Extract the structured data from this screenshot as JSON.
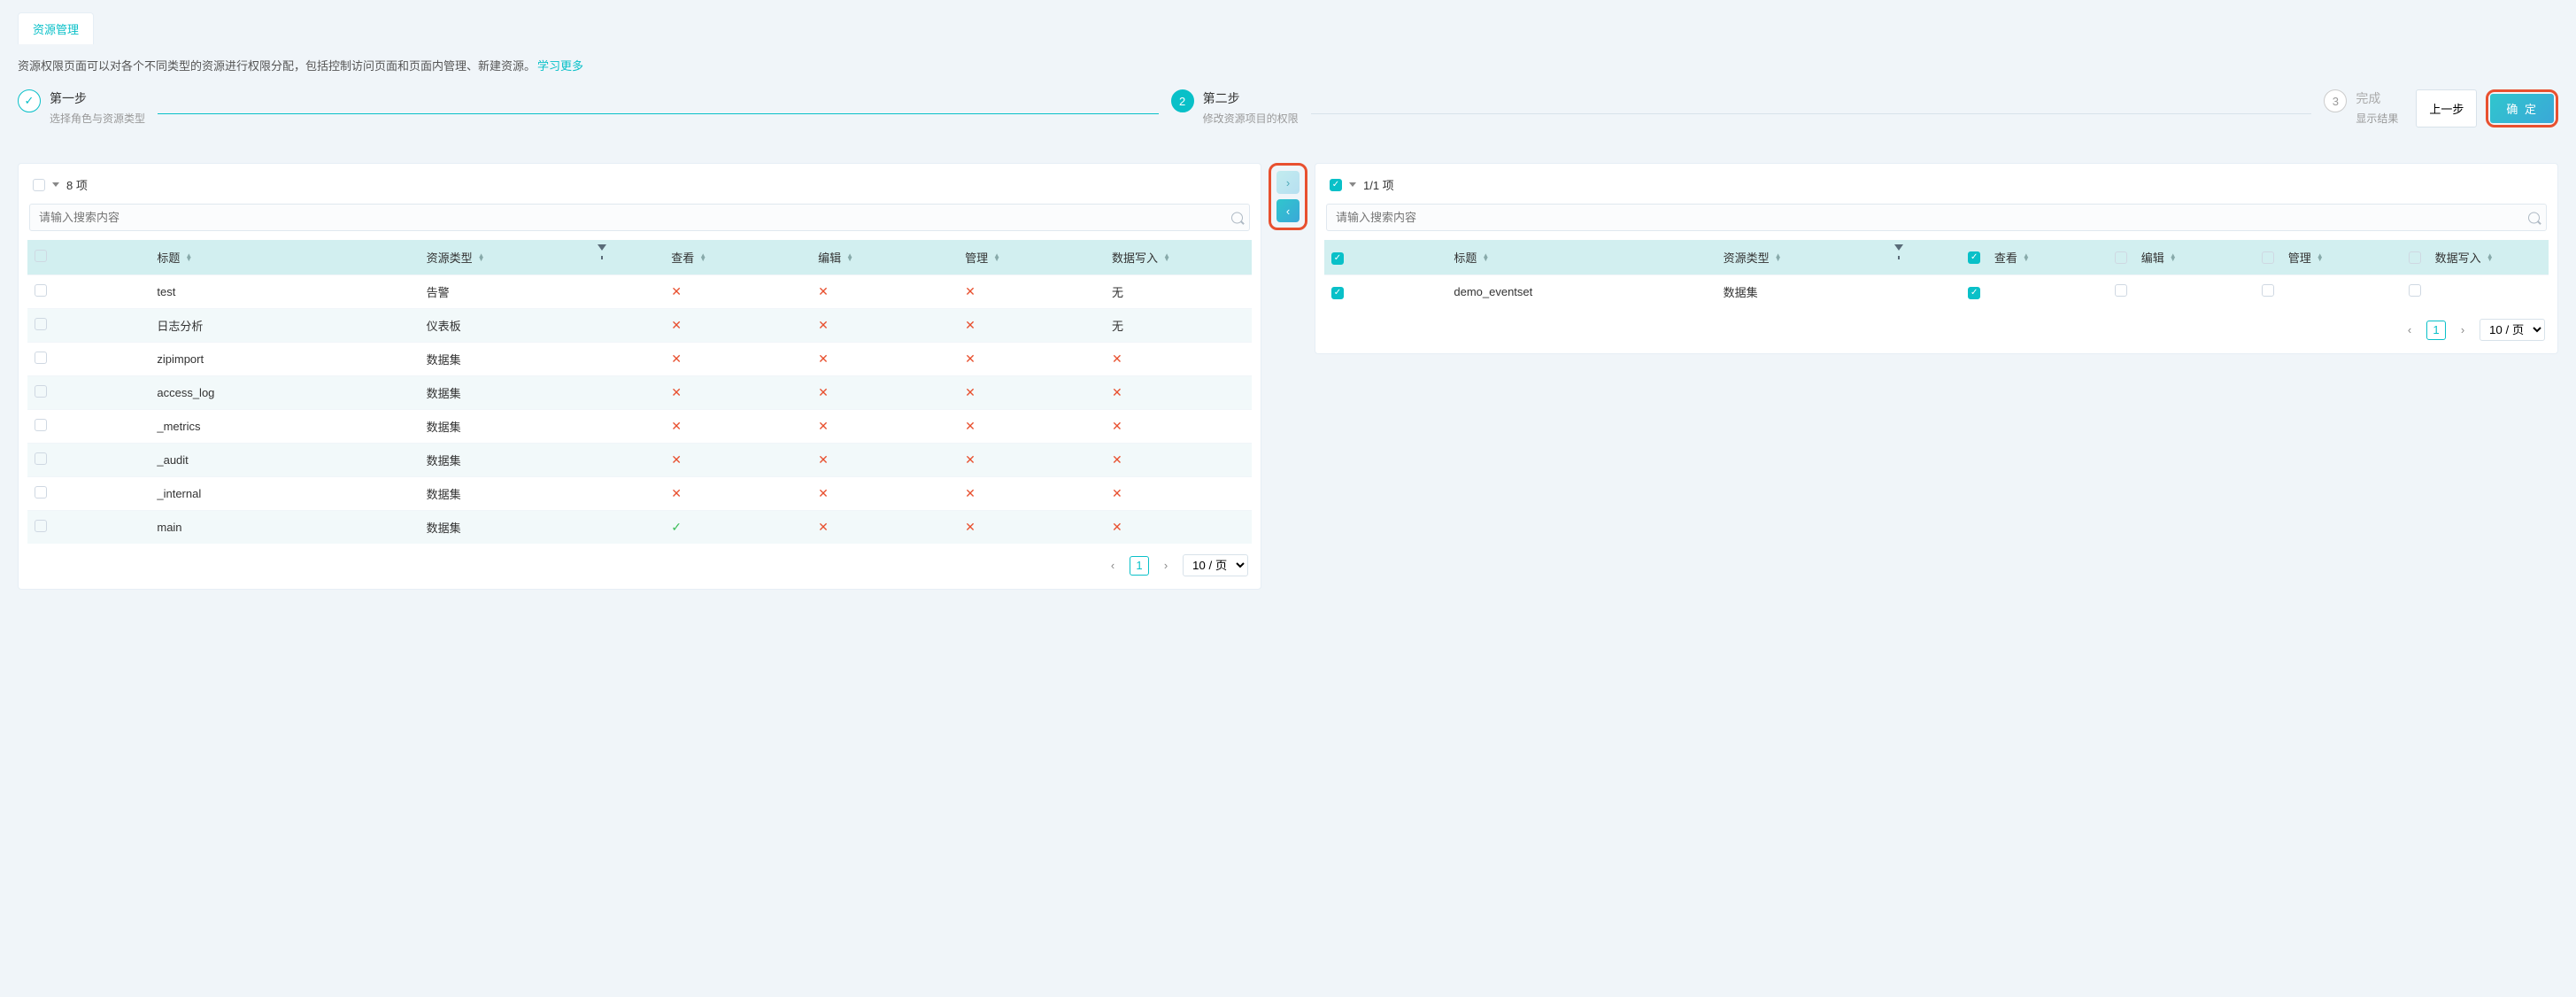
{
  "tab": {
    "label": "资源管理"
  },
  "description": {
    "text": "资源权限页面可以对各个不同类型的资源进行权限分配，包括控制访问页面和页面内管理、新建资源。",
    "learn_more": "学习更多"
  },
  "steps": [
    {
      "title": "第一步",
      "sub": "选择角色与资源类型",
      "state": "done"
    },
    {
      "title": "第二步",
      "sub": "修改资源项目的权限",
      "state": "active",
      "num": "2"
    },
    {
      "title": "完成",
      "sub": "显示结果",
      "state": "wait",
      "num": "3"
    }
  ],
  "buttons": {
    "prev": "上一步",
    "confirm": "确 定"
  },
  "left": {
    "count": "8 项",
    "search_ph": "请输入搜索内容",
    "columns": {
      "title": "标题",
      "type": "资源类型",
      "view": "查看",
      "edit": "编辑",
      "manage": "管理",
      "write": "数据写入"
    },
    "rows": [
      {
        "title": "test",
        "type": "告警",
        "view": "x",
        "edit": "x",
        "manage": "x",
        "write": "无"
      },
      {
        "title": "日志分析",
        "type": "仪表板",
        "view": "x",
        "edit": "x",
        "manage": "x",
        "write": "无"
      },
      {
        "title": "zipimport",
        "type": "数据集",
        "view": "x",
        "edit": "x",
        "manage": "x",
        "write": "x"
      },
      {
        "title": "access_log",
        "type": "数据集",
        "view": "x",
        "edit": "x",
        "manage": "x",
        "write": "x"
      },
      {
        "title": "_metrics",
        "type": "数据集",
        "view": "x",
        "edit": "x",
        "manage": "x",
        "write": "x"
      },
      {
        "title": "_audit",
        "type": "数据集",
        "view": "x",
        "edit": "x",
        "manage": "x",
        "write": "x"
      },
      {
        "title": "_internal",
        "type": "数据集",
        "view": "x",
        "edit": "x",
        "manage": "x",
        "write": "x"
      },
      {
        "title": "main",
        "type": "数据集",
        "view": "check",
        "edit": "x",
        "manage": "x",
        "write": "x"
      }
    ],
    "page": {
      "cur": "1",
      "size": "10 / 页"
    }
  },
  "right": {
    "count": "1/1 项",
    "search_ph": "请输入搜索内容",
    "columns": {
      "title": "标题",
      "type": "资源类型",
      "view": "查看",
      "edit": "编辑",
      "manage": "管理",
      "write": "数据写入"
    },
    "rows": [
      {
        "title": "demo_eventset",
        "type": "数据集",
        "view": true,
        "edit": false,
        "manage": false,
        "write": false
      }
    ],
    "page": {
      "cur": "1",
      "size": "10 / 页"
    }
  }
}
